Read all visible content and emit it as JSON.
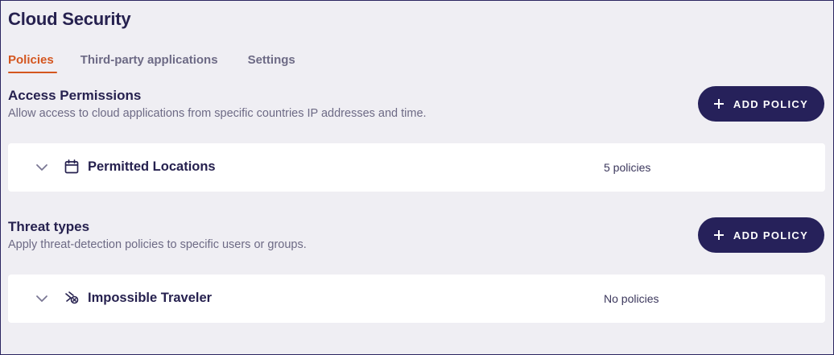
{
  "page": {
    "title": "Cloud Security"
  },
  "tabs": [
    {
      "label": "Policies",
      "active": true
    },
    {
      "label": "Third-party applications",
      "active": false
    },
    {
      "label": "Settings",
      "active": false
    }
  ],
  "sections": [
    {
      "title": "Access Permissions",
      "description": "Allow access to cloud applications from specific countries IP addresses and time.",
      "add_button_label": "ADD POLICY",
      "card": {
        "icon": "calendar-icon",
        "title": "Permitted Locations",
        "count": "5 policies"
      }
    },
    {
      "title": "Threat types",
      "description": "Apply threat-detection policies to specific users or groups.",
      "add_button_label": "ADD POLICY",
      "card": {
        "icon": "traveler-icon",
        "title": "Impossible Traveler",
        "count": "No policies"
      }
    }
  ],
  "colors": {
    "background": "#efeef3",
    "primary_dark": "#26215a",
    "accent": "#d4561f",
    "muted_text": "#6d6a85",
    "card": "#ffffff"
  }
}
